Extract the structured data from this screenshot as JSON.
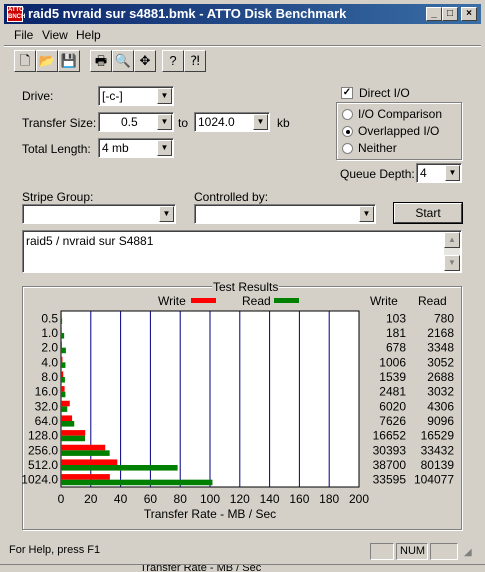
{
  "window": {
    "title": "raid5 nvraid sur s4881.bmk - ATTO Disk Benchmark",
    "icon_text": "ATTO BENCH 32",
    "controls": [
      "minimize-icon",
      "maximize-icon",
      "close-icon"
    ]
  },
  "menu": [
    "File",
    "View",
    "Help"
  ],
  "toolbar": [
    "new-file-icon",
    "open-folder-icon",
    "save-icon",
    "print-icon",
    "print-preview-icon",
    "move-icon",
    "help-icon",
    "context-help-icon"
  ],
  "form": {
    "drive_label": "Drive:",
    "drive_value": "[-c-]",
    "transfer_size_label": "Transfer Size:",
    "transfer_from": "0.5",
    "to_label": "to",
    "transfer_to": "1024.0",
    "kb_label": "kb",
    "total_length_label": "Total Length:",
    "total_length_value": "4 mb",
    "direct_io_label": "Direct I/O",
    "direct_io_checked": true,
    "io_options": [
      {
        "label": "I/O Comparison",
        "selected": false
      },
      {
        "label": "Overlapped I/O",
        "selected": true
      },
      {
        "label": "Neither",
        "selected": false
      }
    ],
    "queue_depth_label": "Queue Depth:",
    "queue_depth_value": "4",
    "stripe_group_label": "Stripe Group:",
    "stripe_group_value": "",
    "controlled_by_label": "Controlled by:",
    "controlled_by_value": "",
    "start_label": "Start",
    "description": "raid5 / nvraid sur S4881"
  },
  "results": {
    "group_title": "Test Results",
    "write_legend": "Write",
    "read_legend": "Read",
    "write_col_header": "Write",
    "read_col_header": "Read",
    "colors": {
      "write": "#ff0000",
      "read": "#008000",
      "grid": "#000080"
    }
  },
  "chart_data": {
    "type": "bar",
    "orientation": "horizontal",
    "categories": [
      "0.5",
      "1.0",
      "2.0",
      "4.0",
      "8.0",
      "16.0",
      "32.0",
      "64.0",
      "128.0",
      "256.0",
      "512.0",
      "1024.0"
    ],
    "series": [
      {
        "name": "Write",
        "values": [
          103,
          181,
          678,
          1006,
          1539,
          2481,
          6020,
          7626,
          16652,
          30393,
          38700,
          33595
        ]
      },
      {
        "name": "Read",
        "values": [
          780,
          2168,
          3348,
          3052,
          2688,
          3032,
          4306,
          9096,
          16529,
          33432,
          80139,
          104077
        ]
      }
    ],
    "x_ticks": [
      "0",
      "20",
      "40",
      "60",
      "80",
      "100",
      "120",
      "140",
      "160",
      "180",
      "200"
    ],
    "xlim": [
      0,
      200
    ],
    "xlabel": "Transfer Rate - MB / Sec",
    "grid": true
  },
  "statusbar": {
    "help_text": "For Help, press F1",
    "num_indicator": "NUM"
  },
  "bottom_strip_text": "Transfer Rate - MB / Sec"
}
